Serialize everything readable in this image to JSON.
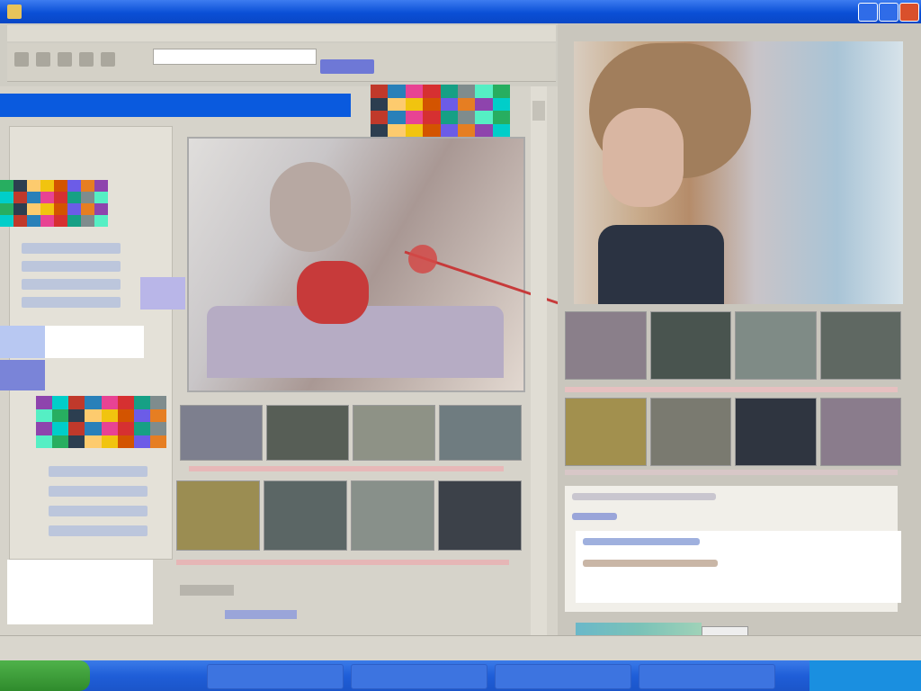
{
  "window": {
    "title": ""
  },
  "menu": {
    "items": [
      "",
      "",
      "",
      "",
      "",
      ""
    ]
  },
  "toolbar": {
    "address_value": "",
    "go_label": ""
  },
  "left": {
    "selection_text": "",
    "webcam_caption": "",
    "bottom_label": "",
    "bottom_link": ""
  },
  "right": {
    "lines": [
      "",
      "",
      "",
      ""
    ]
  },
  "status": {
    "left": "",
    "right": ""
  },
  "taskbar": {
    "start_label": "",
    "items": [
      "",
      "",
      "",
      ""
    ],
    "clock": ""
  },
  "colors": {
    "titlebar": "#0a4fd6",
    "selection": "#0a5ade",
    "taskbar": "#1f5ed8",
    "start": "#2f8b2c",
    "highlight_red": "#c73a3a"
  },
  "icons": {
    "app": "app-icon",
    "minimize": "minimize-icon",
    "maximize": "maximize-icon",
    "close": "close-icon"
  }
}
